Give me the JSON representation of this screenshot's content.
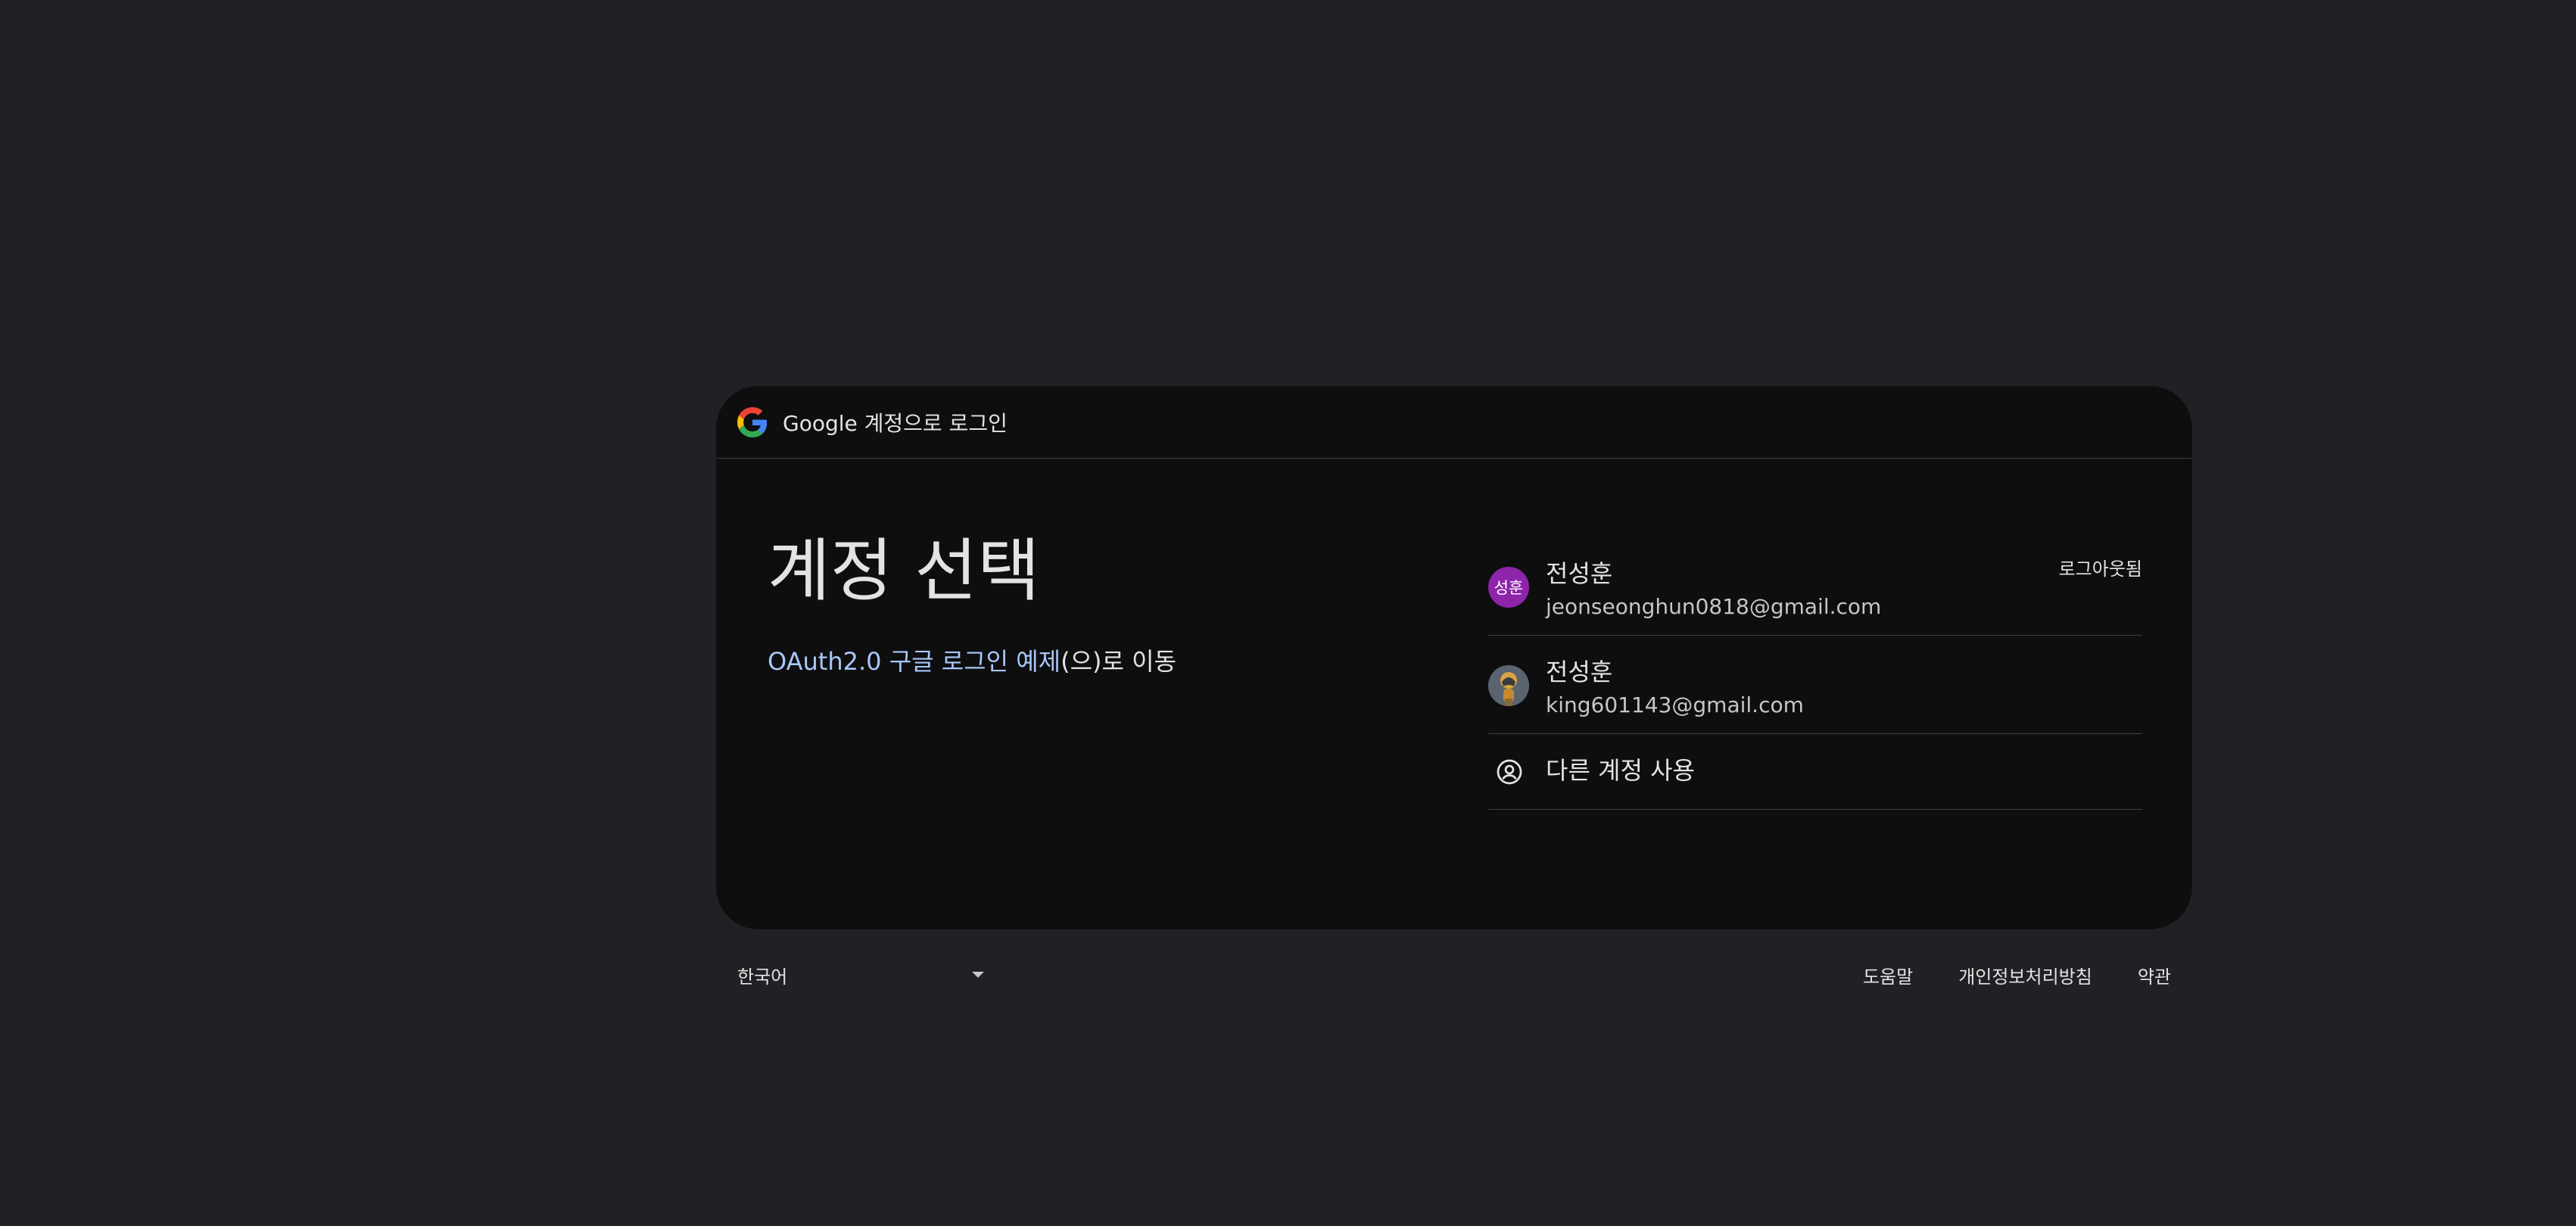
{
  "header": {
    "title": "Google 계정으로 로그인"
  },
  "main": {
    "title": "계정 선택",
    "app_name": "OAuth2.0 구글 로그인 예제",
    "subtitle_suffix": "(으)로 이동"
  },
  "accounts": [
    {
      "name": "전성훈",
      "email": "jeonseonghun0818@gmail.com",
      "avatar_initials": "성훈",
      "avatar_color": "#8e24aa",
      "status": "로그아웃됨"
    },
    {
      "name": "전성훈",
      "email": "king601143@gmail.com",
      "avatar_icon": "profile-photo"
    }
  ],
  "other_account": {
    "label": "다른 계정 사용",
    "icon": "account-circle-icon"
  },
  "footer": {
    "language": "한국어",
    "links": [
      "도움말",
      "개인정보처리방침",
      "약관"
    ]
  },
  "colors": {
    "background": "#202124",
    "card": "#0e0e0e",
    "link": "#a8c7fa",
    "divider": "#3c4043"
  }
}
